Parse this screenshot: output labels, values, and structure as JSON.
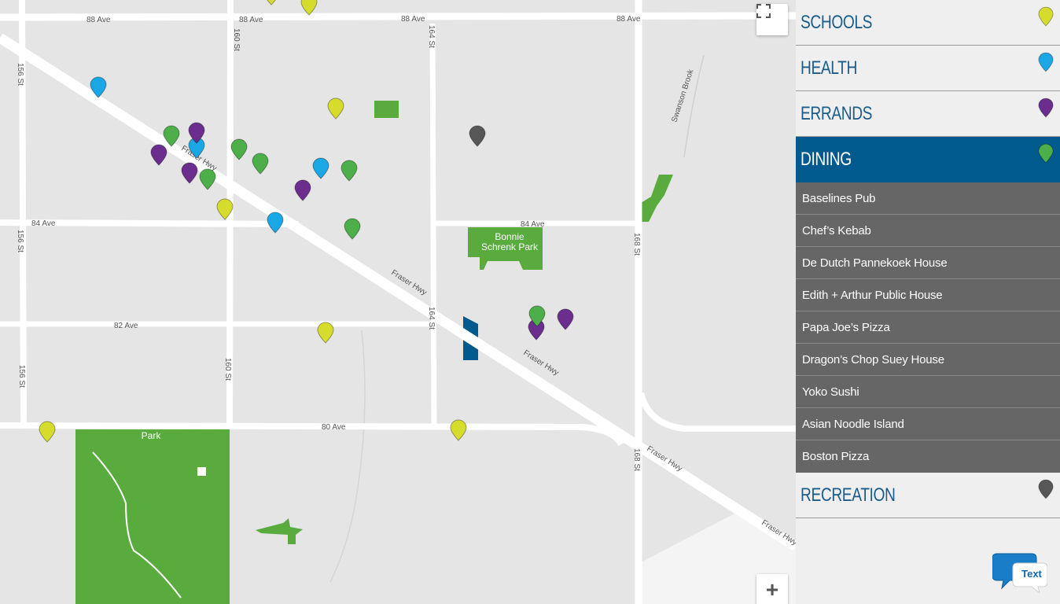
{
  "map": {
    "roads": {
      "ave_88": "88 Ave",
      "ave_84": "84 Ave",
      "ave_82": "82 Ave",
      "ave_80": "80 Ave",
      "st_156": "156 St",
      "st_160": "160 St",
      "st_164": "164 St",
      "st_168": "168 St",
      "fraser_hwy": "Fraser Hwy",
      "swanson_brook": "Swanson Brook"
    },
    "parks": {
      "bonnie_line1": "Bonnie",
      "bonnie_line2": "Schrenk Park",
      "fleetwood": "Park"
    },
    "controls": {
      "zoom_in": "+"
    }
  },
  "colors": {
    "schools": "#d6dc2c",
    "health": "#1aa7e6",
    "errands": "#6b2e8f",
    "dining": "#4caf4a",
    "recreation": "#575757",
    "park": "#5aab3e",
    "accent": "#005a8e"
  },
  "sidebar": {
    "categories": [
      {
        "label": "SCHOOLS",
        "key": "schools"
      },
      {
        "label": "HEALTH",
        "key": "health"
      },
      {
        "label": "ERRANDS",
        "key": "errands"
      },
      {
        "label": "DINING",
        "key": "dining",
        "active": true,
        "items": [
          "Baselines Pub",
          "Chef’s Kebab",
          "De Dutch Pannekoek House",
          "Edith + Arthur Public House",
          "Papa Joe’s Pizza",
          "Dragon’s Chop Suey House",
          "Yoko Sushi",
          "Asian Noodle Island",
          "Boston Pizza"
        ]
      },
      {
        "label": "RECREATION",
        "key": "recreation"
      }
    ]
  },
  "chat": {
    "label": "Text"
  }
}
